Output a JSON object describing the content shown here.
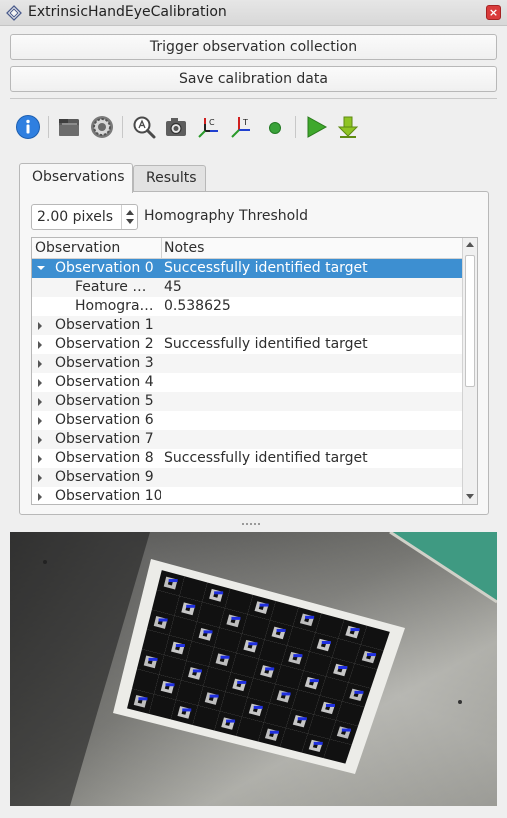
{
  "window": {
    "title": "ExtrinsicHandEyeCalibration",
    "close_glyph": "×"
  },
  "buttons": {
    "trigger": "Trigger observation collection",
    "save": "Save calibration data"
  },
  "toolbar": {
    "icons": [
      "info-icon",
      "folder-icon",
      "settings-icon",
      "zoom-icon",
      "camera-icon",
      "camera-frame-icon",
      "target-frame-icon",
      "status-dot-icon",
      "play-icon",
      "download-icon"
    ]
  },
  "tabs": {
    "observations": "Observations",
    "results": "Results"
  },
  "threshold": {
    "value": "2.00 pixels",
    "label": "Homography Threshold"
  },
  "tree": {
    "headers": [
      "Observation",
      "Notes"
    ],
    "rows": [
      {
        "label": "Observation 0",
        "notes": "Successfully identified target",
        "level": 0,
        "expanded": true,
        "selected": true
      },
      {
        "label": "Feature …",
        "notes": "45",
        "level": 1
      },
      {
        "label": "Homogra…",
        "notes": "0.538625",
        "level": 1
      },
      {
        "label": "Observation 1",
        "notes": "",
        "level": 0
      },
      {
        "label": "Observation 2",
        "notes": "Successfully identified target",
        "level": 0
      },
      {
        "label": "Observation 3",
        "notes": "",
        "level": 0
      },
      {
        "label": "Observation 4",
        "notes": "",
        "level": 0
      },
      {
        "label": "Observation 5",
        "notes": "",
        "level": 0
      },
      {
        "label": "Observation 6",
        "notes": "",
        "level": 0
      },
      {
        "label": "Observation 7",
        "notes": "",
        "level": 0
      },
      {
        "label": "Observation 8",
        "notes": "Successfully identified target",
        "level": 0
      },
      {
        "label": "Observation 9",
        "notes": "",
        "level": 0
      },
      {
        "label": "Observation 10",
        "notes": "",
        "level": 0
      }
    ]
  },
  "colors": {
    "selection": "#3d8fd1",
    "close": "#d93b3b",
    "marker_labels": "#1f2fe0"
  }
}
